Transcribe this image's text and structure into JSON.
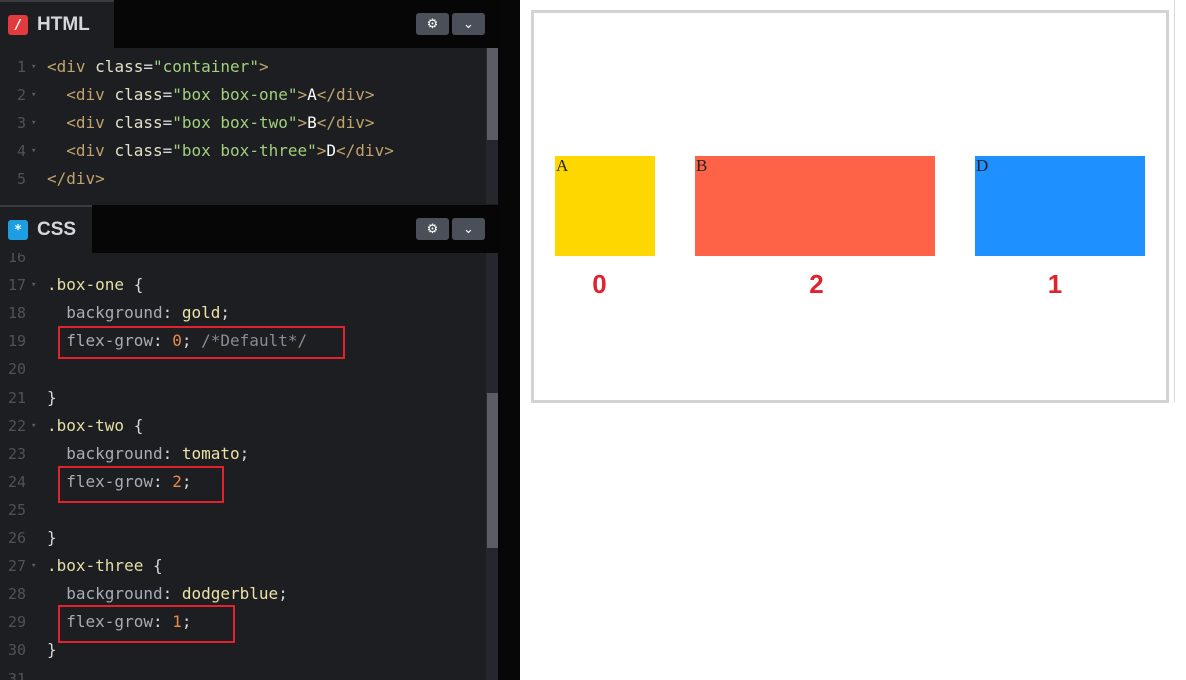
{
  "html_pane": {
    "title": "HTML",
    "icon_glyph": "/",
    "settings_icon": "gear-icon",
    "collapse_icon": "chevron-down-icon",
    "lines": [
      {
        "num": "1",
        "fold": "▾",
        "tokens": [
          {
            "t": "<div ",
            "c": "t-tag"
          },
          {
            "t": "class",
            "c": "t-attr"
          },
          {
            "t": "=",
            "c": "t-punc"
          },
          {
            "t": "\"container\"",
            "c": "t-str"
          },
          {
            "t": ">",
            "c": "t-tag"
          }
        ]
      },
      {
        "num": "2",
        "fold": "▾",
        "tokens": [
          {
            "t": "  <div ",
            "c": "t-tag"
          },
          {
            "t": "class",
            "c": "t-attr"
          },
          {
            "t": "=",
            "c": "t-punc"
          },
          {
            "t": "\"box box-one\"",
            "c": "t-str"
          },
          {
            "t": ">",
            "c": "t-tag"
          },
          {
            "t": "A",
            "c": "t-text"
          },
          {
            "t": "</div>",
            "c": "t-tag"
          }
        ]
      },
      {
        "num": "3",
        "fold": "▾",
        "tokens": [
          {
            "t": "  <div ",
            "c": "t-tag"
          },
          {
            "t": "class",
            "c": "t-attr"
          },
          {
            "t": "=",
            "c": "t-punc"
          },
          {
            "t": "\"box box-two\"",
            "c": "t-str"
          },
          {
            "t": ">",
            "c": "t-tag"
          },
          {
            "t": "B",
            "c": "t-text"
          },
          {
            "t": "</div>",
            "c": "t-tag"
          }
        ]
      },
      {
        "num": "4",
        "fold": "▾",
        "tokens": [
          {
            "t": "  <div ",
            "c": "t-tag"
          },
          {
            "t": "class",
            "c": "t-attr"
          },
          {
            "t": "=",
            "c": "t-punc"
          },
          {
            "t": "\"box box-three\"",
            "c": "t-str"
          },
          {
            "t": ">",
            "c": "t-tag"
          },
          {
            "t": "D",
            "c": "t-text"
          },
          {
            "t": "</div>",
            "c": "t-tag"
          }
        ]
      },
      {
        "num": "5",
        "fold": "",
        "tokens": [
          {
            "t": "</div>",
            "c": "t-tag"
          }
        ]
      }
    ]
  },
  "css_pane": {
    "title": "CSS",
    "icon_glyph": "*",
    "settings_icon": "gear-icon",
    "collapse_icon": "chevron-down-icon",
    "lines": [
      {
        "num": "16",
        "fold": "",
        "tokens": []
      },
      {
        "num": "17",
        "fold": "▾",
        "tokens": [
          {
            "t": ".box-one",
            "c": "t-sel"
          },
          {
            "t": " {",
            "c": "t-punc"
          }
        ]
      },
      {
        "num": "18",
        "fold": "",
        "tokens": [
          {
            "t": "  background",
            "c": "t-prop"
          },
          {
            "t": ": ",
            "c": "t-punc"
          },
          {
            "t": "gold",
            "c": "t-val"
          },
          {
            "t": ";",
            "c": "t-punc"
          }
        ]
      },
      {
        "num": "19",
        "fold": "",
        "tokens": [
          {
            "t": "  flex-grow",
            "c": "t-prop"
          },
          {
            "t": ": ",
            "c": "t-punc"
          },
          {
            "t": "0",
            "c": "t-num"
          },
          {
            "t": "; ",
            "c": "t-punc"
          },
          {
            "t": "/*Default*/",
            "c": "t-com"
          }
        ]
      },
      {
        "num": "20",
        "fold": "",
        "tokens": []
      },
      {
        "num": "21",
        "fold": "",
        "tokens": [
          {
            "t": "}",
            "c": "t-punc"
          }
        ]
      },
      {
        "num": "22",
        "fold": "▾",
        "tokens": [
          {
            "t": ".box-two",
            "c": "t-sel"
          },
          {
            "t": " {",
            "c": "t-punc"
          }
        ]
      },
      {
        "num": "23",
        "fold": "",
        "tokens": [
          {
            "t": "  background",
            "c": "t-prop"
          },
          {
            "t": ": ",
            "c": "t-punc"
          },
          {
            "t": "tomato",
            "c": "t-val"
          },
          {
            "t": ";",
            "c": "t-punc"
          }
        ]
      },
      {
        "num": "24",
        "fold": "",
        "tokens": [
          {
            "t": "  flex-grow",
            "c": "t-prop"
          },
          {
            "t": ": ",
            "c": "t-punc"
          },
          {
            "t": "2",
            "c": "t-num"
          },
          {
            "t": ";",
            "c": "t-punc"
          }
        ]
      },
      {
        "num": "25",
        "fold": "",
        "tokens": []
      },
      {
        "num": "26",
        "fold": "",
        "tokens": [
          {
            "t": "}",
            "c": "t-punc"
          }
        ]
      },
      {
        "num": "27",
        "fold": "▾",
        "tokens": [
          {
            "t": ".box-three",
            "c": "t-sel"
          },
          {
            "t": " {",
            "c": "t-punc"
          }
        ]
      },
      {
        "num": "28",
        "fold": "",
        "tokens": [
          {
            "t": "  background",
            "c": "t-prop"
          },
          {
            "t": ": ",
            "c": "t-punc"
          },
          {
            "t": "dodgerblue",
            "c": "t-val"
          },
          {
            "t": ";",
            "c": "t-punc"
          }
        ]
      },
      {
        "num": "29",
        "fold": "",
        "tokens": [
          {
            "t": "  flex-grow",
            "c": "t-prop"
          },
          {
            "t": ": ",
            "c": "t-punc"
          },
          {
            "t": "1",
            "c": "t-num"
          },
          {
            "t": ";",
            "c": "t-punc"
          }
        ]
      },
      {
        "num": "30",
        "fold": "",
        "tokens": [
          {
            "t": "}",
            "c": "t-punc"
          }
        ]
      },
      {
        "num": "31",
        "fold": "",
        "tokens": []
      }
    ]
  },
  "preview": {
    "boxes": [
      {
        "label": "A",
        "color": "#ffd700"
      },
      {
        "label": "B",
        "color": "#ff6347"
      },
      {
        "label": "D",
        "color": "#1e90ff"
      }
    ],
    "grow_annotations": [
      "0",
      "2",
      "1"
    ],
    "annotation_color": "#e1232d"
  }
}
